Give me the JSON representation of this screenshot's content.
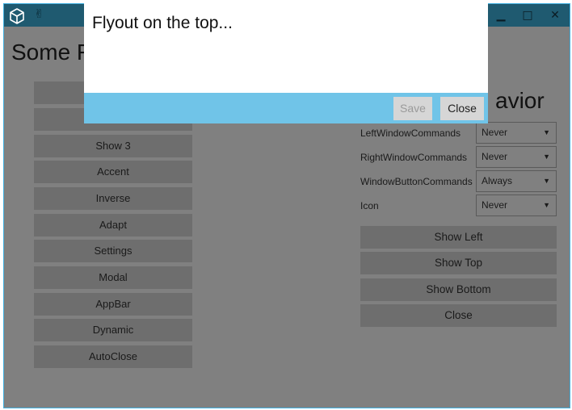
{
  "window": {
    "title_icons": [
      "cube-icon",
      "peace-hand-icon"
    ],
    "controls": {
      "minimize": "▁",
      "maximize": "□",
      "close": "✕"
    }
  },
  "main": {
    "left_title_fragment": "Some F",
    "right_title_fragment": "avior"
  },
  "left_buttons": [
    "",
    "",
    "Show 3",
    "Accent",
    "Inverse",
    "Adapt",
    "Settings",
    "Modal",
    "AppBar",
    "Dynamic",
    "AutoClose"
  ],
  "settings": [
    {
      "label": "LeftWindowCommands",
      "value": "Never"
    },
    {
      "label": "RightWindowCommands",
      "value": "Never"
    },
    {
      "label": "WindowButtonCommands",
      "value": "Always"
    },
    {
      "label": "Icon",
      "value": "Never"
    }
  ],
  "right_buttons": [
    "Show Left",
    "Show Top",
    "Show Bottom",
    "Close"
  ],
  "flyout": {
    "title": "Flyout on the top...",
    "save_label": "Save",
    "close_label": "Close",
    "band_color": "#70c4e8"
  }
}
